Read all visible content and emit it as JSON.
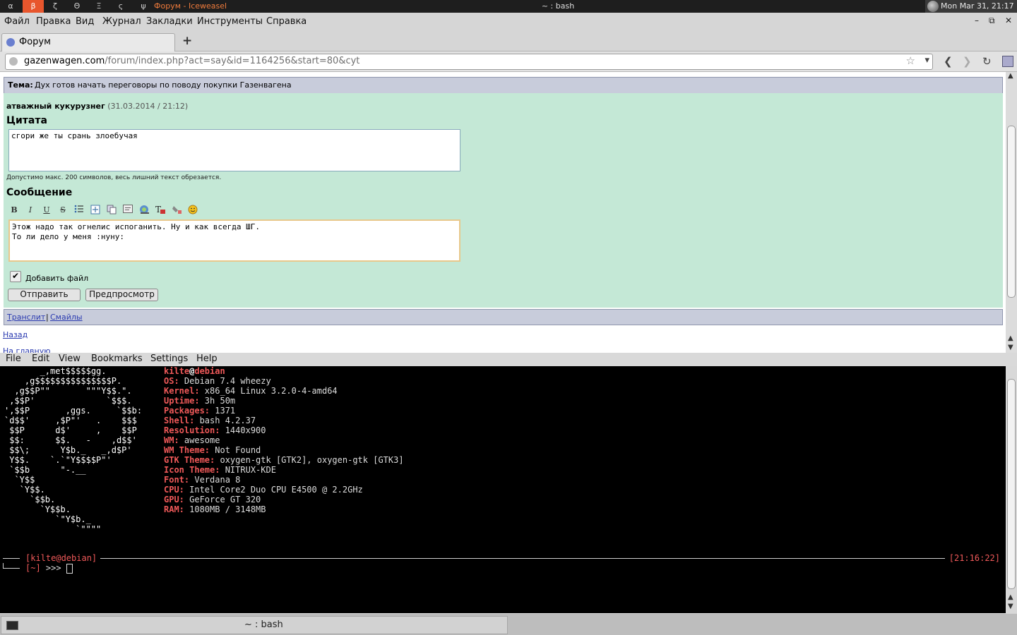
{
  "wm": {
    "tags": [
      "α",
      "β",
      "ζ",
      "Θ",
      "Ξ",
      "ς",
      "ψ"
    ],
    "active_tag": "β",
    "task_title": "Форум - Iceweasel",
    "center_title": "~ : bash",
    "clock": "Mon Mar 31, 21:17"
  },
  "browser": {
    "menu": [
      "Файл",
      "Правка",
      "Вид",
      "Журнал",
      "Закладки",
      "Инструменты",
      "Справка"
    ],
    "window_controls": [
      "–",
      "⧉",
      "✕"
    ],
    "tab_title": "Форум",
    "new_tab": "+",
    "url_host": "gazenwagen.com",
    "url_path": "/forum/index.php?act=say&id=1164256&start=80&cyt",
    "star": "☆",
    "dropdown": "▾",
    "nav_back": "❮",
    "nav_forward": "❯",
    "nav_reload": "↻"
  },
  "page": {
    "topic_label": "Тема:",
    "topic_title": "Дух готов начать переговоры по поводу покупки Газенвагена",
    "author": "атважный кукурузнег",
    "author_date": "(31.03.2014 / 21:12)",
    "quote_heading": "Цитата",
    "quote_text": "сгори же ты срань злоебучая",
    "hint": "Допустимо макс. 200 символов, весь лишний текст обрезается.",
    "message_heading": "Сообщение",
    "toolbar": [
      "B",
      "I",
      "U",
      "S"
    ],
    "message_text": "Этож надо так огнелис испоганить. Ну и как всегда ШГ.\nТо ли дело у меня :нуну:",
    "attach_label": "Добавить файл",
    "attach_checked": "✔",
    "send_button": "Отправить",
    "preview_button": "Предпросмотр",
    "translit_link": "Транслит",
    "separator": "|",
    "smiles_link": "Смайлы",
    "back_link": "Назад",
    "home_link": "На главную"
  },
  "konsole": {
    "menu": [
      "File",
      "Edit",
      "View",
      "Bookmarks",
      "Settings",
      "Help"
    ],
    "ascii_logo": "       _,met$$$$$gg.\n    ,g$$$$$$$$$$$$$$$P.\n  ,g$$P\"\"       \"\"\"Y$$.\".\n ,$$P'              `$$$.\n',$$P       ,ggs.     `$$b:\n`d$$'     ,$P\"'   .    $$$\n $$P      d$'     ,    $$P\n $$:      $$.   -    ,d$$'\n $$\\;      Y$b._   _,d$P'\n Y$$.    `.`\"Y$$$$P\"'\n `$$b      \"-.__\n  `Y$$\n   `Y$$.\n     `$$b.\n       `Y$$b.\n          `\"Y$b._\n              `\"\"\"\"",
    "user": "kilte",
    "at": "@",
    "host": "debian",
    "info": [
      {
        "key": "OS:",
        "value": " Debian 7.4 wheezy"
      },
      {
        "key": "Kernel:",
        "value": " x86_64 Linux 3.2.0-4-amd64"
      },
      {
        "key": "Uptime:",
        "value": " 3h 50m"
      },
      {
        "key": "Packages:",
        "value": " 1371"
      },
      {
        "key": "Shell:",
        "value": " bash 4.2.37"
      },
      {
        "key": "Resolution:",
        "value": " 1440x900"
      },
      {
        "key": "WM:",
        "value": " awesome"
      },
      {
        "key": "WM Theme:",
        "value": " Not Found"
      },
      {
        "key": "GTK Theme:",
        "value": " oxygen-gtk [GTK2], oxygen-gtk [GTK3]"
      },
      {
        "key": "Icon Theme:",
        "value": " NITRUX-KDE"
      },
      {
        "key": "Font:",
        "value": " Verdana 8"
      },
      {
        "key": "CPU:",
        "value": " Intel Core2 Duo CPU E4500 @ 2.2GHz"
      },
      {
        "key": "GPU:",
        "value": " GeForce GT 320"
      },
      {
        "key": "RAM:",
        "value": " 1080MB / 3148MB"
      }
    ],
    "prompt_userhost": "[kilte@debian]",
    "prompt_time": "[21:16:22]",
    "prompt_dir": "[~]",
    "prompt_arrows": " >>> "
  },
  "taskbar": {
    "label": "~ : bash"
  }
}
